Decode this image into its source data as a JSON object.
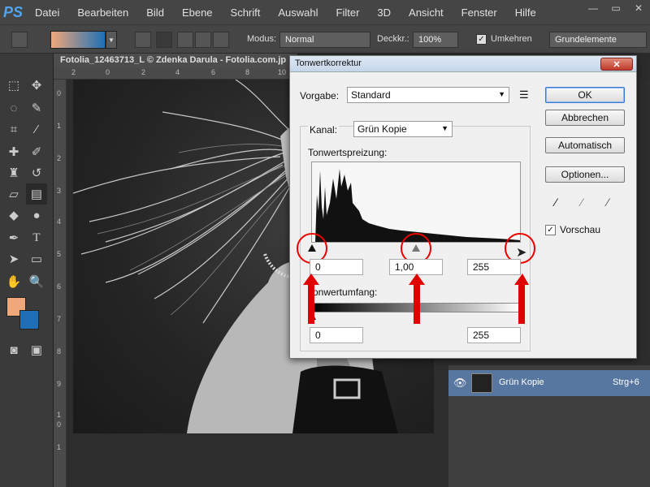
{
  "app": {
    "logo": "PS"
  },
  "menu": [
    "Datei",
    "Bearbeiten",
    "Bild",
    "Ebene",
    "Schrift",
    "Auswahl",
    "Filter",
    "3D",
    "Ansicht",
    "Fenster",
    "Hilfe"
  ],
  "window_controls": {
    "minimize": "—",
    "maximize": "▭",
    "close": "✕"
  },
  "options_bar": {
    "mode_label": "Modus:",
    "mode_value": "Normal",
    "opacity_label": "Deckkr.:",
    "opacity_value": "100%",
    "reverse_label": "Umkehren",
    "workspace": "Grundelemente"
  },
  "document": {
    "tab_title": "Fotolia_12463713_L © Zdenka Darula - Fotolia.com.jp",
    "ruler_h": [
      "2",
      "0",
      "2",
      "4",
      "6",
      "8",
      "10"
    ],
    "ruler_v": [
      "0",
      "1",
      "2",
      "3",
      "4",
      "5",
      "6",
      "7",
      "8",
      "9",
      "1",
      "0",
      "1"
    ]
  },
  "layers": {
    "row_name": "Grün Kopie",
    "row_shortcut": "Strg+6"
  },
  "dialog": {
    "title": "Tonwertkorrektur",
    "close": "✕",
    "preset_label": "Vorgabe:",
    "preset_value": "Standard",
    "channel_label": "Kanal:",
    "channel_value": "Grün Kopie",
    "input_levels_label": "Tonwertspreizung:",
    "input_black": "0",
    "input_gamma": "1,00",
    "input_white": "255",
    "output_levels_label": "Tonwertumfang:",
    "output_black": "0",
    "output_white": "255",
    "buttons": {
      "ok": "OK",
      "cancel": "Abbrechen",
      "auto": "Automatisch",
      "options": "Optionen..."
    },
    "preview_label": "Vorschau",
    "preview_checked": true
  },
  "colors": {
    "foreground": "#f0a87a",
    "background": "#1e6fb5",
    "accent_red": "#e00000",
    "layer_highlight": "#5877a0"
  }
}
